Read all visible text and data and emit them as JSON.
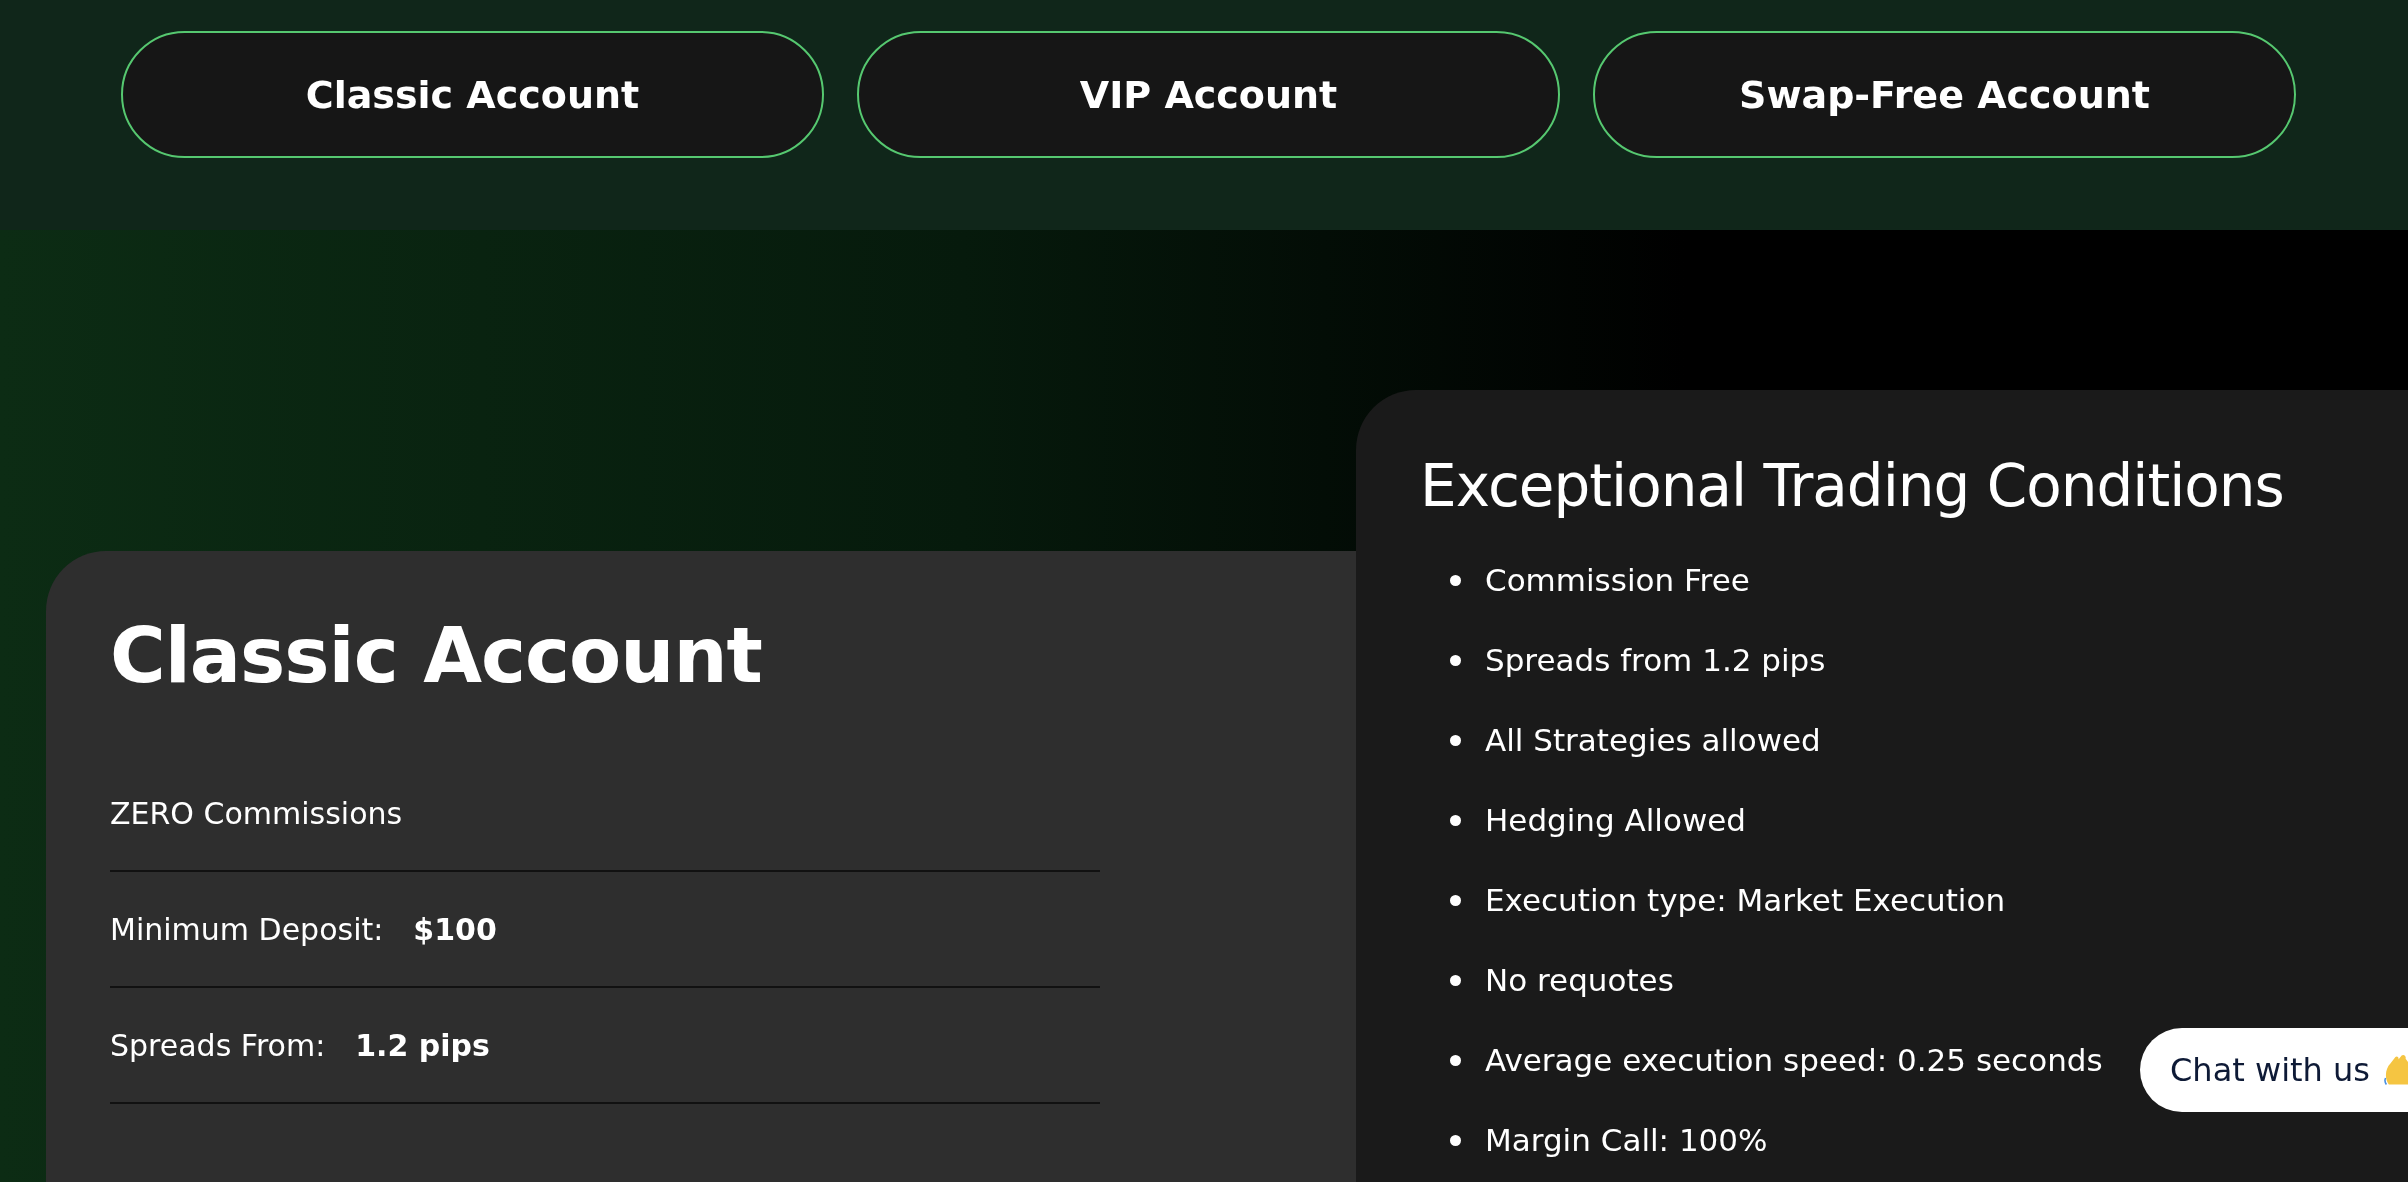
{
  "account_tabs": [
    {
      "label": "Classic Account"
    },
    {
      "label": "VIP Account"
    },
    {
      "label": "Swap-Free Account"
    }
  ],
  "account_card": {
    "title": "Classic Account",
    "rows": [
      {
        "label": "ZERO Commissions"
      },
      {
        "label": "Minimum Deposit:",
        "value": "$100"
      },
      {
        "label": "Spreads From:",
        "value": "1.2 pips"
      }
    ]
  },
  "conditions_card": {
    "title": "Exceptional Trading Conditions",
    "items": [
      "Commission Free",
      "Spreads from 1.2 pips",
      "All Strategies allowed",
      "Hedging Allowed",
      "Execution type: Market Execution",
      "No requotes",
      "Average execution speed: 0.25 seconds",
      "Margin Call: 100%"
    ]
  },
  "chat_widget": {
    "label": "Chat with us"
  }
}
